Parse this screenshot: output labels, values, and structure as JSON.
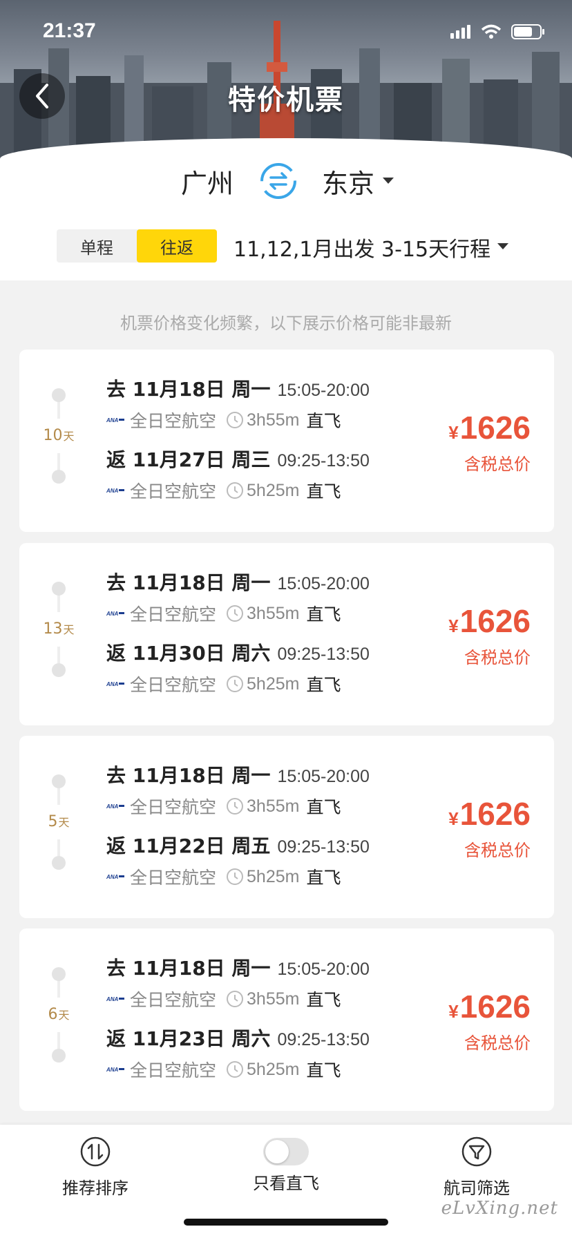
{
  "status_bar": {
    "time": "21:37"
  },
  "header": {
    "title": "特价机票"
  },
  "route": {
    "from": "广州",
    "to": "东京"
  },
  "trip_type": {
    "options": [
      "单程",
      "往返"
    ],
    "selected": "往返"
  },
  "departure_filter": "11,12,1月出发 3-15天行程",
  "notice": "机票价格变化频繁，以下展示价格可能非最新",
  "currency_symbol": "¥",
  "price_note": "含税总价",
  "flights": [
    {
      "days": "10",
      "days_unit": "天",
      "outbound": {
        "head": "去 11月18日 周一",
        "time": "15:05-20:00",
        "airline": "全日空航空",
        "duration": "3h55m",
        "type": "直飞"
      },
      "return": {
        "head": "返 11月27日 周三",
        "time": "09:25-13:50",
        "airline": "全日空航空",
        "duration": "5h25m",
        "type": "直飞"
      },
      "price": "1626"
    },
    {
      "days": "13",
      "days_unit": "天",
      "outbound": {
        "head": "去 11月18日 周一",
        "time": "15:05-20:00",
        "airline": "全日空航空",
        "duration": "3h55m",
        "type": "直飞"
      },
      "return": {
        "head": "返 11月30日 周六",
        "time": "09:25-13:50",
        "airline": "全日空航空",
        "duration": "5h25m",
        "type": "直飞"
      },
      "price": "1626"
    },
    {
      "days": "5",
      "days_unit": "天",
      "outbound": {
        "head": "去 11月18日 周一",
        "time": "15:05-20:00",
        "airline": "全日空航空",
        "duration": "3h55m",
        "type": "直飞"
      },
      "return": {
        "head": "返 11月22日 周五",
        "time": "09:25-13:50",
        "airline": "全日空航空",
        "duration": "5h25m",
        "type": "直飞"
      },
      "price": "1626"
    },
    {
      "days": "6",
      "days_unit": "天",
      "outbound": {
        "head": "去 11月18日 周一",
        "time": "15:05-20:00",
        "airline": "全日空航空",
        "duration": "3h55m",
        "type": "直飞"
      },
      "return": {
        "head": "返 11月23日 周六",
        "time": "09:25-13:50",
        "airline": "全日空航空",
        "duration": "5h25m",
        "type": "直飞"
      },
      "price": "1626"
    }
  ],
  "bottom_bar": {
    "sort_label": "推荐排序",
    "direct_only_label": "只看直飞",
    "direct_only_on": false,
    "airline_filter_label": "航司筛选"
  },
  "watermark": "eLvXing.net",
  "colors": {
    "accent_yellow": "#ffd60a",
    "price_red": "#e8543a",
    "days_gold": "#b38a4a",
    "swap_blue": "#3aa6e8"
  },
  "icons": [
    "back-arrow-icon",
    "swap-icon",
    "ana-logo-icon",
    "clock-icon",
    "sort-icon",
    "filter-icon",
    "signal-icon",
    "wifi-icon",
    "battery-icon"
  ]
}
